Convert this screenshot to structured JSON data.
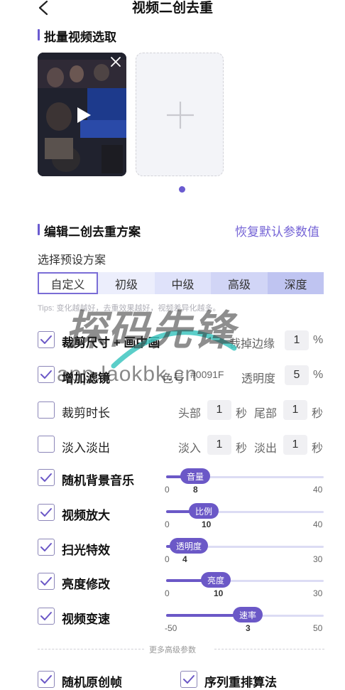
{
  "header": {
    "title": "视频二创去重",
    "back_icon": "chevron-left-icon"
  },
  "batch": {
    "title": "批量视频选取"
  },
  "video": {
    "close_icon": "close-icon",
    "play_icon": "play-icon",
    "add_icon": "plus-icon"
  },
  "scheme": {
    "title": "编辑二创去重方案",
    "restore": "恢复默认参数值",
    "subtitle": "选择预设方案",
    "tabs": [
      "自定义",
      "初级",
      "中级",
      "高级",
      "深度"
    ],
    "tips": "Tips: 变化越越好，去重效果越好，视频差异化越多。"
  },
  "options": {
    "crop": {
      "label": "裁剪尺寸 + 画中画",
      "checked": true,
      "margin_label": "裁掉边缘",
      "margin_value": "1",
      "unit": "%"
    },
    "filter": {
      "label": "增加滤镜",
      "checked": true,
      "color_label": "色号",
      "color_value": "#0091F",
      "opacity_label": "透明度",
      "opacity_value": "5",
      "unit": "%"
    },
    "trim": {
      "label": "裁剪时长",
      "checked": false,
      "head_label": "头部",
      "head_value": "1",
      "tail_label": "尾部",
      "tail_value": "1",
      "unit": "秒"
    },
    "fade": {
      "label": "淡入淡出",
      "checked": false,
      "in_label": "淡入",
      "in_value": "1",
      "out_label": "淡出",
      "out_value": "1",
      "unit": "秒"
    },
    "music": {
      "label": "随机背景音乐",
      "checked": true,
      "bubble": "音量",
      "min": "0",
      "value": "8",
      "max": "40",
      "fraction": 0.2
    },
    "zoom": {
      "label": "视频放大",
      "checked": true,
      "bubble": "比例",
      "min": "0",
      "value": "10",
      "max": "40",
      "fraction": 0.25
    },
    "sweep": {
      "label": "扫光特效",
      "checked": true,
      "bubble": "透明度",
      "min": "0",
      "value": "4",
      "max": "30",
      "fraction": 0.13
    },
    "brightness": {
      "label": "亮度修改",
      "checked": true,
      "bubble": "亮度",
      "min": "0",
      "value": "10",
      "max": "30",
      "fraction": 0.33
    },
    "speed": {
      "label": "视频变速",
      "checked": true,
      "bubble": "速率",
      "min": "-50",
      "value": "3",
      "max": "50",
      "fraction": 0.53
    }
  },
  "more": {
    "label": "更多高级参数",
    "random_frame": {
      "label": "随机原创帧",
      "checked": true
    },
    "reorder": {
      "label": "序列重排算法",
      "checked": true
    }
  },
  "watermark": {
    "main": "探码先锋",
    "sub": "app.laokbk.cn"
  },
  "colors": {
    "accent": "#6b58c7",
    "link": "#7564d6"
  }
}
